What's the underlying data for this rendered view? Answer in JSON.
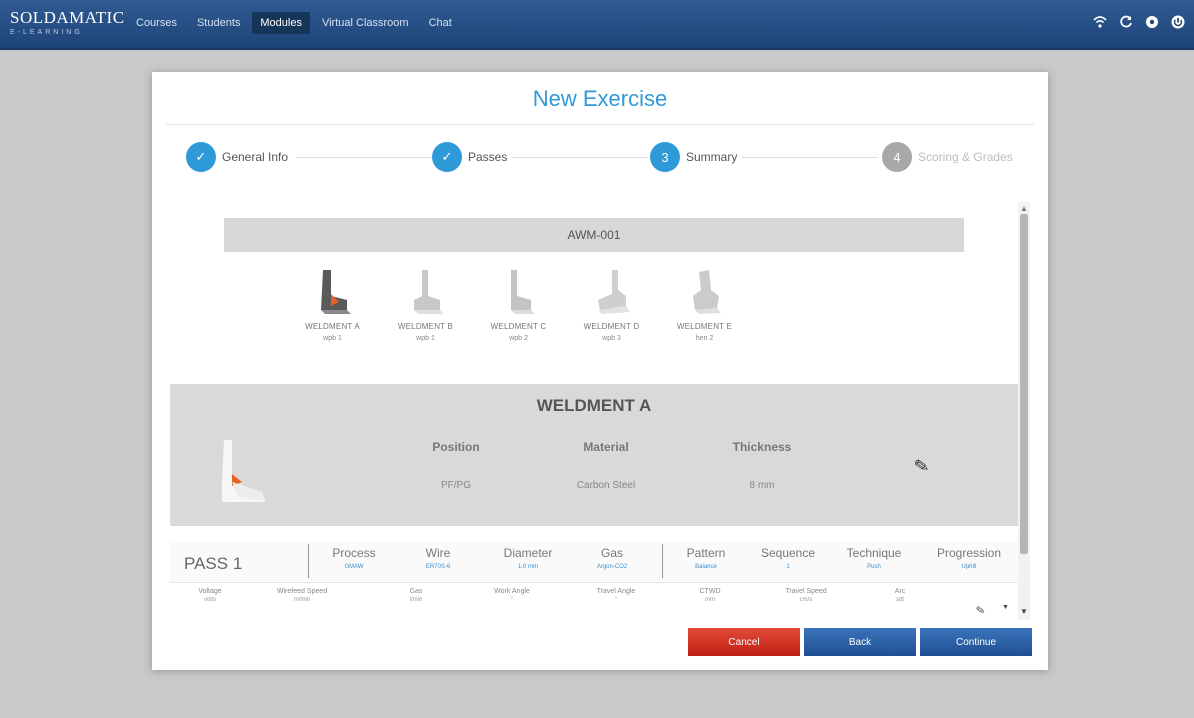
{
  "app": {
    "logo": "SOLDAMATIC",
    "logo_sub": "E-LEARNING"
  },
  "nav": {
    "items": [
      {
        "label": "Courses"
      },
      {
        "label": "Students"
      },
      {
        "label": "Modules",
        "active": true
      },
      {
        "label": "Virtual Classroom"
      },
      {
        "label": "Chat"
      }
    ]
  },
  "top_icons": [
    "wifi-icon",
    "refresh-icon",
    "settings-icon",
    "power-icon"
  ],
  "modal": {
    "title": "New Exercise"
  },
  "stepper": {
    "steps": [
      {
        "number": "✓",
        "label": "General Info",
        "state": "done"
      },
      {
        "number": "✓",
        "label": "Passes",
        "state": "done"
      },
      {
        "number": "3",
        "label": "Summary",
        "state": "current"
      },
      {
        "number": "4",
        "label": "Scoring & Grades",
        "state": "inactive"
      }
    ]
  },
  "summary": {
    "exercise_code": "AWM-001",
    "weldments": [
      {
        "name": "WELDMENT A",
        "sub": "wpb 1"
      },
      {
        "name": "WELDMENT B",
        "sub": "wpb 1"
      },
      {
        "name": "WELDMENT C",
        "sub": "wpb 2"
      },
      {
        "name": "WELDMENT D",
        "sub": "wpb 3"
      },
      {
        "name": "WELDMENT E",
        "sub": "hen 2"
      }
    ],
    "selected": {
      "title": "WELDMENT A",
      "position_label": "Position",
      "position_value": "PF/PG",
      "material_label": "Material",
      "material_value": "Carbon Steel",
      "thickness_label": "Thickness",
      "thickness_value": "8 mm"
    },
    "pass": {
      "label": "PASS 1",
      "columns": [
        {
          "header": "Process",
          "value": "GMAW"
        },
        {
          "header": "Wire",
          "value": "ER70S-6"
        },
        {
          "header": "Diameter",
          "value": "1.0 mm"
        },
        {
          "header": "Gas",
          "value": "Argon-CO2"
        },
        {
          "header": "Pattern",
          "value": "Balance"
        },
        {
          "header": "Sequence",
          "value": "1"
        },
        {
          "header": "Technique",
          "value": "Push"
        },
        {
          "header": "Progression",
          "value": "Uphill"
        }
      ],
      "params": [
        {
          "header": "Voltage",
          "value": "volts"
        },
        {
          "header": "Wirefeed Speed",
          "value": "m/min"
        },
        {
          "header": "Gas",
          "value": "l/min"
        },
        {
          "header": "Work Angle",
          "value": "°"
        },
        {
          "header": "Travel Angle",
          "value": "°"
        },
        {
          "header": "CTWD",
          "value": "mm"
        },
        {
          "header": "Travel Speed",
          "value": "cm/s"
        },
        {
          "header": "Arc",
          "value": "sdt"
        }
      ]
    }
  },
  "buttons": {
    "cancel": "Cancel",
    "back": "Back",
    "continue": "Continue"
  },
  "colors": {
    "accent": "#2f9ad8",
    "topbar": "#1e4579",
    "cancel": "#c9281a",
    "primary": "#2a5fa6"
  }
}
